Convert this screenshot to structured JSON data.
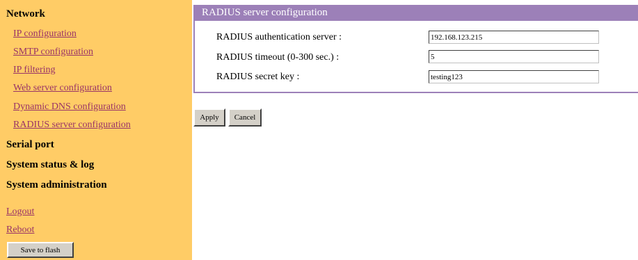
{
  "sidebar": {
    "network_title": "Network",
    "network_links": [
      "IP configuration",
      "SMTP configuration",
      "IP filtering",
      "Web server configuration",
      "Dynamic DNS configuration",
      "RADIUS server configuration"
    ],
    "serial_port": "Serial port",
    "system_status": "System status & log",
    "system_admin": "System administration",
    "logout": "Logout",
    "reboot": "Reboot",
    "save_button": "Save to flash"
  },
  "panel": {
    "title": "RADIUS server configuration",
    "fields": [
      {
        "label": "RADIUS authentication server :",
        "value": "192.168.123.215"
      },
      {
        "label": "RADIUS timeout (0-300 sec.) :",
        "value": "5"
      },
      {
        "label": "RADIUS secret key :",
        "value": "testing123"
      }
    ]
  },
  "actions": {
    "apply": "Apply",
    "cancel": "Cancel"
  },
  "colors": {
    "sidebar_bg": "#ffcc66",
    "header_bg": "#9c80b8",
    "link": "#993366"
  }
}
